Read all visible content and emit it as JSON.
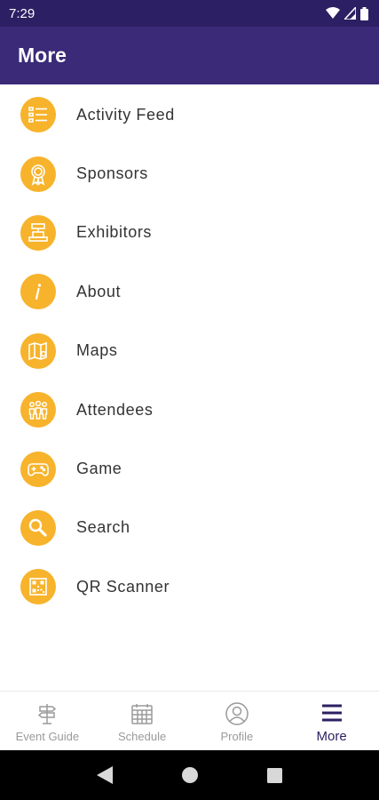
{
  "status_bar": {
    "time": "7:29",
    "icons": [
      "wifi-icon",
      "cellular-signal-icon",
      "battery-icon"
    ]
  },
  "app_bar": {
    "title": "More"
  },
  "menu": {
    "items": [
      {
        "label": "Activity Feed",
        "icon": "activity-feed-icon"
      },
      {
        "label": "Sponsors",
        "icon": "award-ribbon-icon"
      },
      {
        "label": "Exhibitors",
        "icon": "exhibitor-booth-icon"
      },
      {
        "label": "About",
        "icon": "info-icon"
      },
      {
        "label": "Maps",
        "icon": "map-pin-icon"
      },
      {
        "label": "Attendees",
        "icon": "people-icon"
      },
      {
        "label": "Game",
        "icon": "gamepad-icon"
      },
      {
        "label": "Search",
        "icon": "search-icon"
      },
      {
        "label": "QR Scanner",
        "icon": "qr-code-icon"
      }
    ]
  },
  "bottom_nav": {
    "items": [
      {
        "label": "Event Guide",
        "icon": "signpost-icon",
        "active": false
      },
      {
        "label": "Schedule",
        "icon": "calendar-icon",
        "active": false
      },
      {
        "label": "Profile",
        "icon": "person-circle-icon",
        "active": false
      },
      {
        "label": "More",
        "icon": "hamburger-menu-icon",
        "active": true
      }
    ]
  },
  "colors": {
    "status_bar": "#2c1f63",
    "app_bar": "#3a2a78",
    "icon_circle": "#f7b32b",
    "nav_active": "#2c1f63",
    "nav_inactive": "#9a9a9a"
  }
}
